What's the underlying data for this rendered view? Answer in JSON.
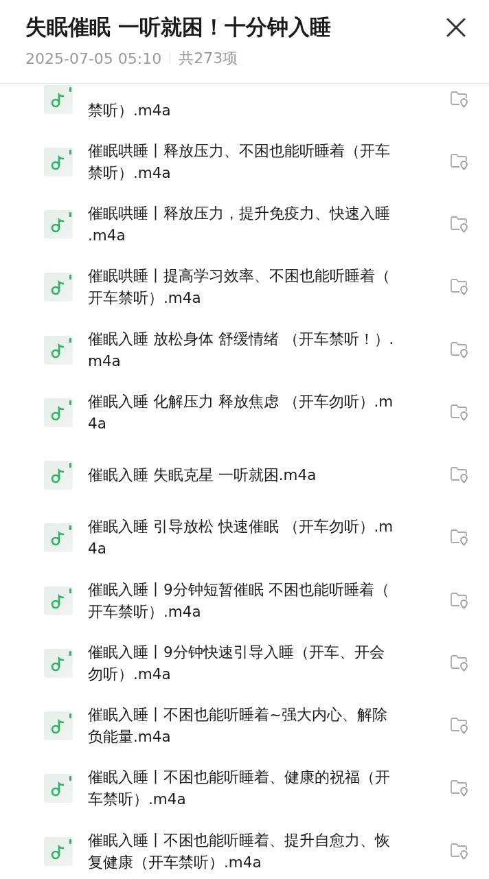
{
  "header": {
    "title": "失眠催眠 一听就困！十分钟入睡",
    "date": "2025-07-05 05:10",
    "count": "共273项"
  },
  "files": [
    {
      "kind": "cut",
      "lines": [
        "禁听）.m4a"
      ]
    },
    {
      "kind": "full",
      "lines": [
        "催眠哄睡丨释放压力、不困也能听睡着（开车",
        "禁听）.m4a"
      ]
    },
    {
      "kind": "full",
      "lines": [
        "催眠哄睡丨释放压力，提升免疫力、快速入睡",
        ".m4a"
      ]
    },
    {
      "kind": "full",
      "lines": [
        "催眠哄睡丨提高学习效率、不困也能听睡着（",
        "开车禁听）.m4a"
      ]
    },
    {
      "kind": "full",
      "lines": [
        "催眠入睡 放松身体 舒缓情绪 （开车禁听！）.",
        "m4a"
      ]
    },
    {
      "kind": "full",
      "lines": [
        "催眠入睡 化解压力 释放焦虑 （开车勿听）.m",
        "4a"
      ]
    },
    {
      "kind": "full",
      "lines": [
        "催眠入睡 失眠克星 一听就困.m4a"
      ]
    },
    {
      "kind": "full",
      "lines": [
        "催眠入睡 引导放松 快速催眠 （开车勿听）.m",
        "4a"
      ]
    },
    {
      "kind": "full",
      "lines": [
        "催眠入睡丨9分钟短暂催眠 不困也能听睡着（",
        "开车禁听）.m4a"
      ]
    },
    {
      "kind": "full",
      "lines": [
        "催眠入睡丨9分钟快速引导入睡（开车、开会",
        "勿听）.m4a"
      ]
    },
    {
      "kind": "full",
      "lines": [
        "催眠入睡丨不困也能听睡着~强大内心、解除",
        "负能量.m4a"
      ]
    },
    {
      "kind": "full",
      "lines": [
        "催眠入睡丨不困也能听睡着、健康的祝福（开",
        "车禁听）.m4a"
      ]
    },
    {
      "kind": "full",
      "lines": [
        "催眠入睡丨不困也能听睡着、提升自愈力、恢",
        "复健康（开车禁听）.m4a"
      ]
    }
  ]
}
